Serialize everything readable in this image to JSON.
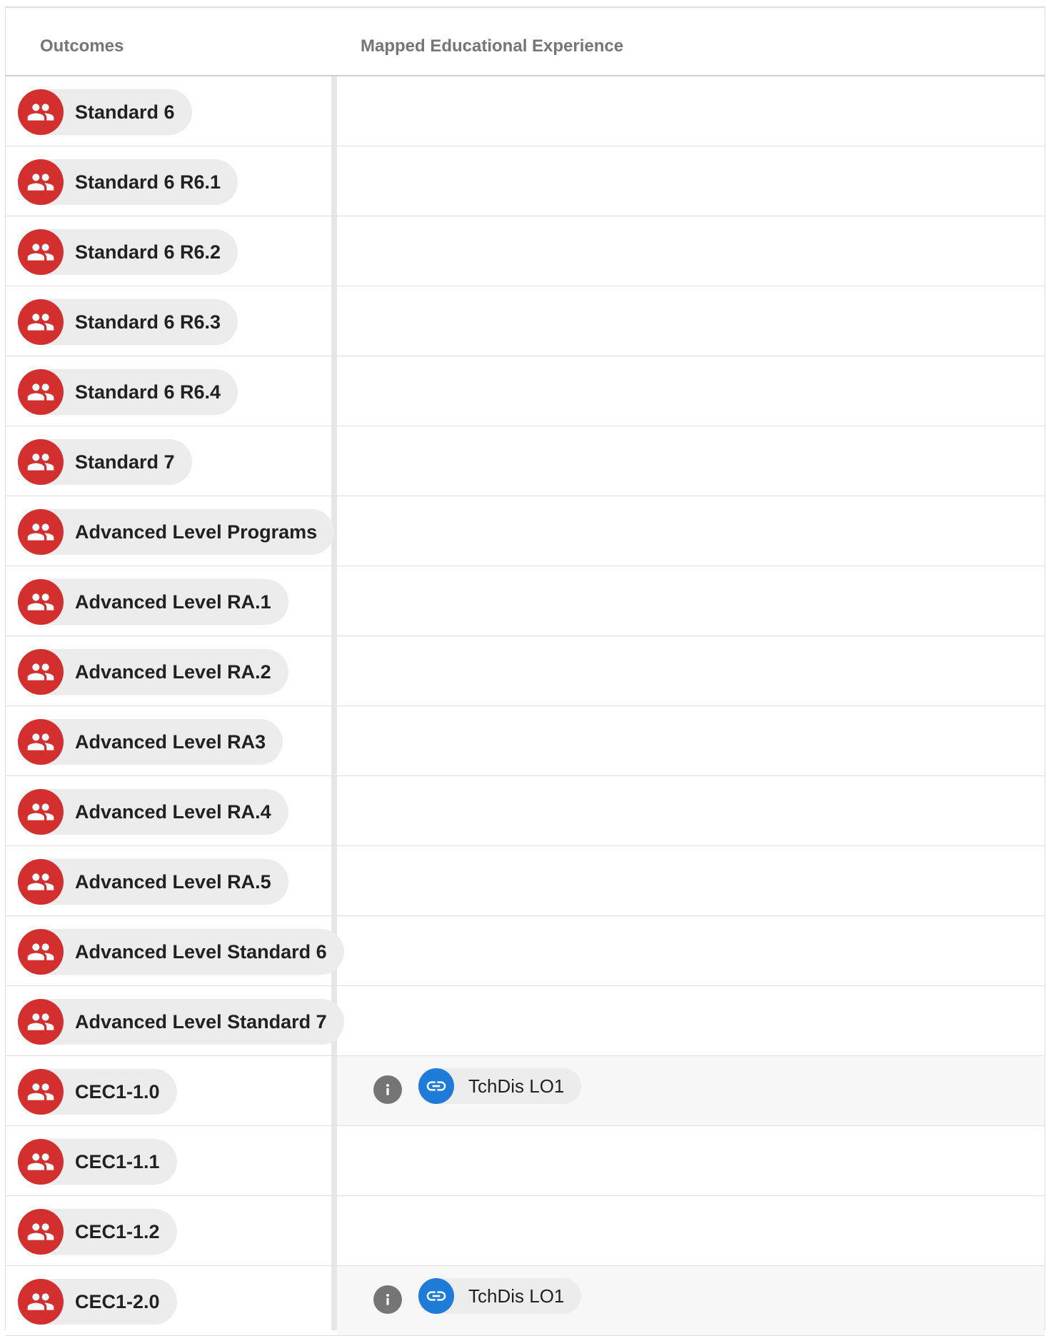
{
  "table": {
    "headers": {
      "outcomes": "Outcomes",
      "mapped": "Mapped Educational Experience"
    },
    "rows": [
      {
        "outcome": "Standard 6",
        "icon": "people-icon",
        "mapped": []
      },
      {
        "outcome": "Standard 6 R6.1",
        "icon": "people-icon",
        "mapped": []
      },
      {
        "outcome": "Standard 6 R6.2",
        "icon": "people-icon",
        "mapped": []
      },
      {
        "outcome": "Standard 6 R6.3",
        "icon": "people-icon",
        "mapped": []
      },
      {
        "outcome": "Standard 6 R6.4",
        "icon": "people-icon",
        "mapped": []
      },
      {
        "outcome": "Standard 7",
        "icon": "people-icon",
        "mapped": []
      },
      {
        "outcome": "Advanced Level Programs",
        "icon": "people-icon",
        "mapped": []
      },
      {
        "outcome": "Advanced Level RA.1",
        "icon": "people-icon",
        "mapped": []
      },
      {
        "outcome": "Advanced Level RA.2",
        "icon": "people-icon",
        "mapped": []
      },
      {
        "outcome": "Advanced Level RA3",
        "icon": "people-icon",
        "mapped": []
      },
      {
        "outcome": "Advanced Level RA.4",
        "icon": "people-icon",
        "mapped": []
      },
      {
        "outcome": "Advanced Level RA.5",
        "icon": "people-icon",
        "mapped": []
      },
      {
        "outcome": "Advanced Level Standard 6",
        "icon": "people-icon",
        "mapped": []
      },
      {
        "outcome": "Advanced Level Standard 7",
        "icon": "people-icon",
        "mapped": []
      },
      {
        "outcome": "CEC1-1.0",
        "icon": "people-icon",
        "mapped": [
          {
            "label": "TchDis LO1",
            "icon": "link-icon",
            "info_icon": "info-icon"
          }
        ]
      },
      {
        "outcome": "CEC1-1.1",
        "icon": "people-icon",
        "mapped": []
      },
      {
        "outcome": "CEC1-1.2",
        "icon": "people-icon",
        "mapped": []
      },
      {
        "outcome": "CEC1-2.0",
        "icon": "people-icon",
        "mapped": [
          {
            "label": "TchDis LO1",
            "icon": "link-icon",
            "info_icon": "info-icon"
          }
        ]
      }
    ]
  },
  "colors": {
    "outcome_avatar": "#d32f2f",
    "link_avatar": "#1e7bd8",
    "info_button": "#757575",
    "chip_background": "#ececec",
    "header_text": "#757575"
  }
}
